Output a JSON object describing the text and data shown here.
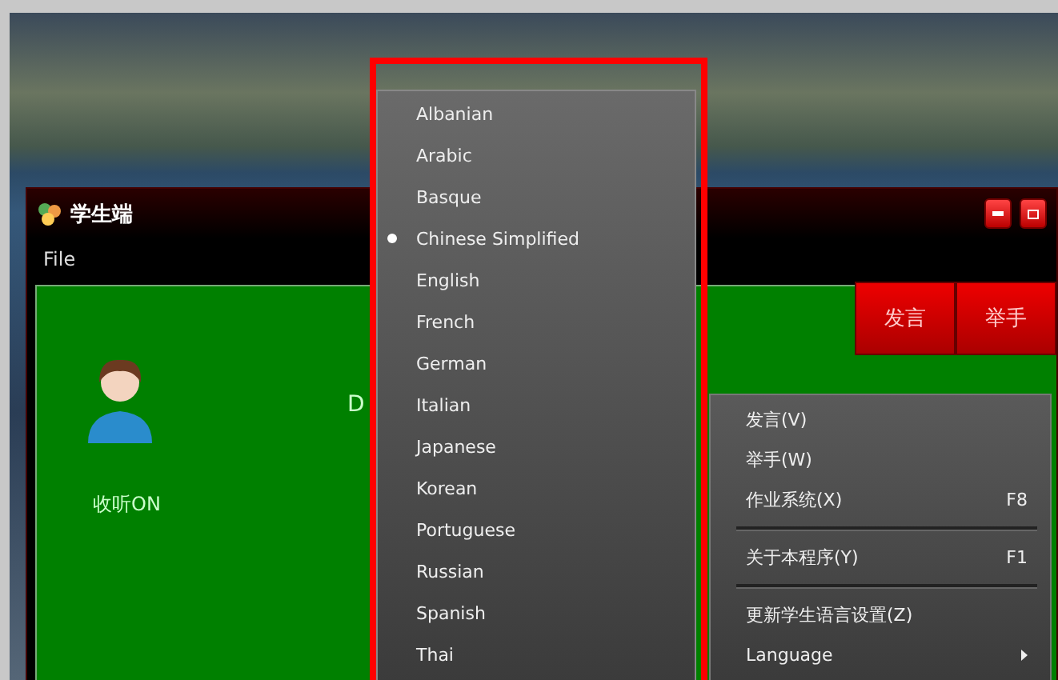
{
  "window": {
    "title": "学生端",
    "menu": [
      "File"
    ],
    "toolbar_buttons": [
      "发言",
      "举手"
    ],
    "student_status": "收听ON",
    "partial_label": "D"
  },
  "context_menu": {
    "items": [
      {
        "kind": "item",
        "label": "发言(V)"
      },
      {
        "kind": "item",
        "label": "举手(W)"
      },
      {
        "kind": "item",
        "label": "作业系统(X)",
        "shortcut": "F8"
      },
      {
        "kind": "separator"
      },
      {
        "kind": "item",
        "label": "关于本程序(Y)",
        "shortcut": "F1"
      },
      {
        "kind": "separator"
      },
      {
        "kind": "item",
        "label": "更新学生语言设置(Z)"
      },
      {
        "kind": "submenu",
        "label": "Language"
      }
    ]
  },
  "language_menu": {
    "items": [
      {
        "label": "Albanian",
        "selected": false
      },
      {
        "label": "Arabic",
        "selected": false
      },
      {
        "label": "Basque",
        "selected": false
      },
      {
        "label": "Chinese Simplified",
        "selected": true
      },
      {
        "label": "English",
        "selected": false
      },
      {
        "label": "French",
        "selected": false
      },
      {
        "label": "German",
        "selected": false
      },
      {
        "label": "Italian",
        "selected": false
      },
      {
        "label": "Japanese",
        "selected": false
      },
      {
        "label": "Korean",
        "selected": false
      },
      {
        "label": "Portuguese",
        "selected": false
      },
      {
        "label": "Russian",
        "selected": false
      },
      {
        "label": "Spanish",
        "selected": false
      },
      {
        "label": "Thai",
        "selected": false
      }
    ]
  }
}
